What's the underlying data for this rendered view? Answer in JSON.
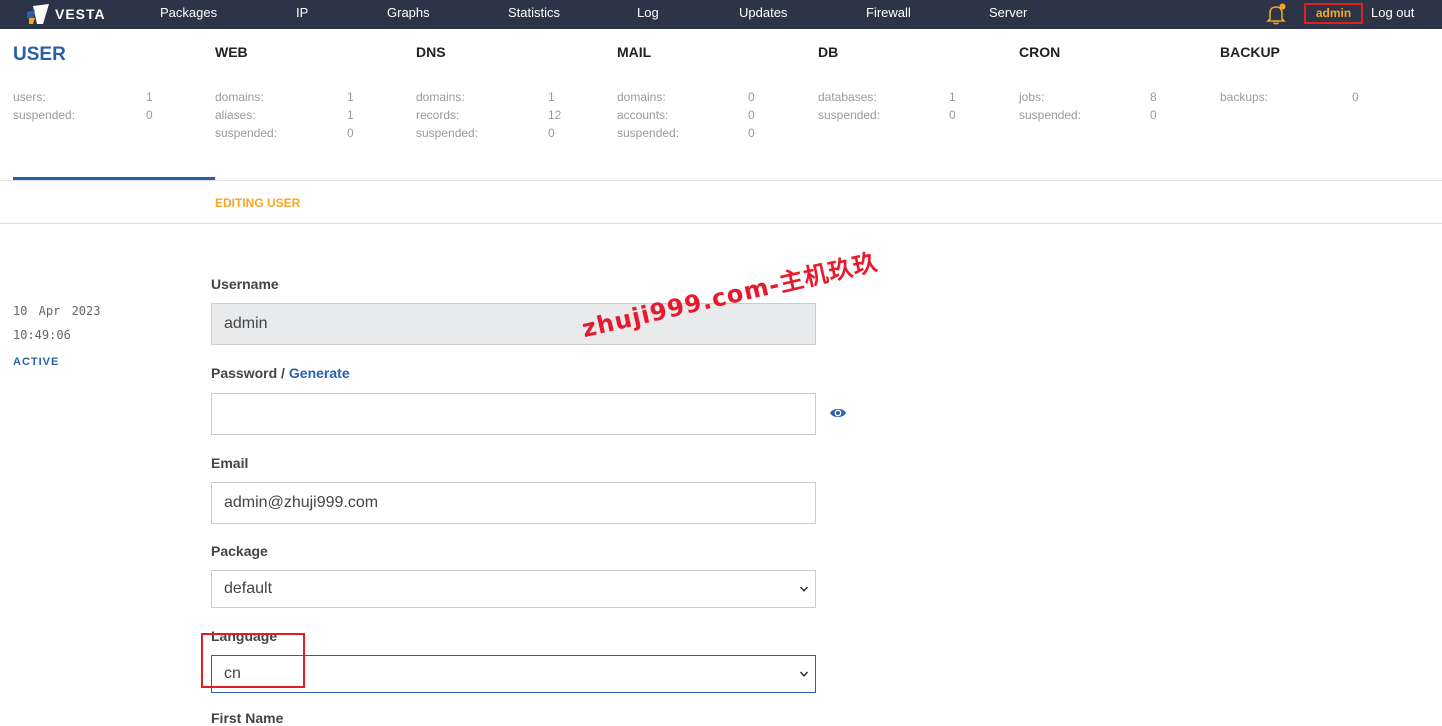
{
  "topbar": {
    "logo_text": "VESTA",
    "nav": [
      "Packages",
      "IP",
      "Graphs",
      "Statistics",
      "Log",
      "Updates",
      "Firewall",
      "Server"
    ],
    "user": "admin",
    "logout": "Log out"
  },
  "stats": {
    "user": {
      "title": "USER",
      "rows": [
        {
          "label": "users:",
          "value": "1"
        },
        {
          "label": "suspended:",
          "value": "0"
        }
      ]
    },
    "web": {
      "title": "WEB",
      "rows": [
        {
          "label": "domains:",
          "value": "1"
        },
        {
          "label": "aliases:",
          "value": "1"
        },
        {
          "label": "suspended:",
          "value": "0"
        }
      ]
    },
    "dns": {
      "title": "DNS",
      "rows": [
        {
          "label": "domains:",
          "value": "1"
        },
        {
          "label": "records:",
          "value": "12"
        },
        {
          "label": "suspended:",
          "value": "0"
        }
      ]
    },
    "mail": {
      "title": "MAIL",
      "rows": [
        {
          "label": "domains:",
          "value": "0"
        },
        {
          "label": "accounts:",
          "value": "0"
        },
        {
          "label": "suspended:",
          "value": "0"
        }
      ]
    },
    "db": {
      "title": "DB",
      "rows": [
        {
          "label": "databases:",
          "value": "1"
        },
        {
          "label": "suspended:",
          "value": "0"
        }
      ]
    },
    "cron": {
      "title": "CRON",
      "rows": [
        {
          "label": "jobs:",
          "value": "8"
        },
        {
          "label": "suspended:",
          "value": "0"
        }
      ]
    },
    "backup": {
      "title": "BACKUP",
      "rows": [
        {
          "label": "backups:",
          "value": "0"
        }
      ]
    }
  },
  "page_heading": "EDITING USER",
  "meta": {
    "date": "10 Apr 2023",
    "time": "10:49:06",
    "status": "ACTIVE"
  },
  "form": {
    "username_label": "Username",
    "username_value": "admin",
    "password_label": "Password /",
    "generate_label": "Generate",
    "password_value": "",
    "email_label": "Email",
    "email_value": "admin@zhuji999.com",
    "package_label": "Package",
    "package_value": "default",
    "language_label": "Language",
    "language_value": "cn",
    "firstname_label": "First Name"
  },
  "watermark": "zhuji999.com-主机玖玖",
  "colors": {
    "topbar": "#2c3447",
    "accent": "#2a5fac",
    "highlight": "#f5a623",
    "annotation": "#e02020"
  }
}
